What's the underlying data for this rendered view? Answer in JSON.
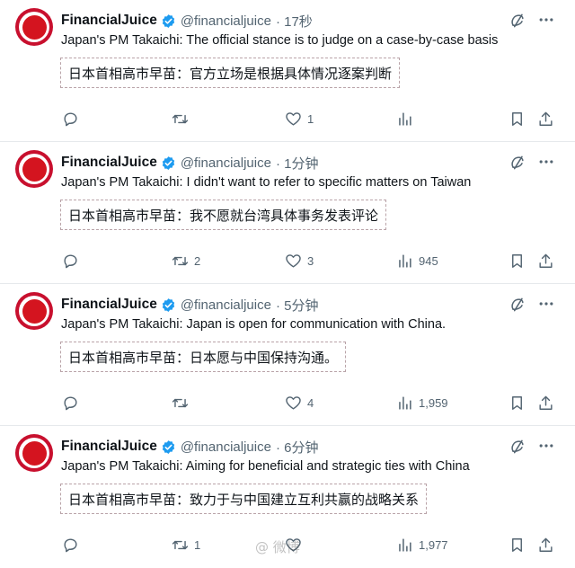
{
  "account": {
    "name": "FinancialJuice",
    "handle": "@financialjuice"
  },
  "posts": [
    {
      "time": "· 17秒",
      "text_en": "Japan's PM Takaichi: The official stance is to judge on a case-by-case basis",
      "text_cn": "日本首相高市早苗：官方立场是根据具体情况逐案判断",
      "replies": "",
      "reposts": "",
      "likes": "1",
      "views": ""
    },
    {
      "time": "· 1分钟",
      "text_en": "Japan's PM Takaichi: I didn't want to refer to specific matters on Taiwan",
      "text_cn": "日本首相高市早苗：我不愿就台湾具体事务发表评论",
      "replies": "",
      "reposts": "2",
      "likes": "3",
      "views": "945"
    },
    {
      "time": "· 5分钟",
      "text_en": "Japan's PM Takaichi: Japan is open for communication with China.",
      "text_cn": "日本首相高市早苗：日本愿与中国保持沟通。",
      "replies": "",
      "reposts": "",
      "likes": "4",
      "views": "1,959"
    },
    {
      "time": "· 6分钟",
      "text_en": "Japan's PM Takaichi: Aiming for beneficial and strategic ties with China",
      "text_cn": "日本首相高市早苗：致力于与中国建立互利共赢的战略关系",
      "replies": "",
      "reposts": "1",
      "likes": "",
      "views": "1,977"
    }
  ],
  "colors": {
    "brand": "#c8102e",
    "verified": "#1d9bf0",
    "muted": "#536471"
  },
  "icons": [
    "verified-badge-icon",
    "edit-icon",
    "more-icon",
    "reply-icon",
    "repost-icon",
    "like-icon",
    "views-icon",
    "bookmark-icon",
    "share-icon"
  ]
}
